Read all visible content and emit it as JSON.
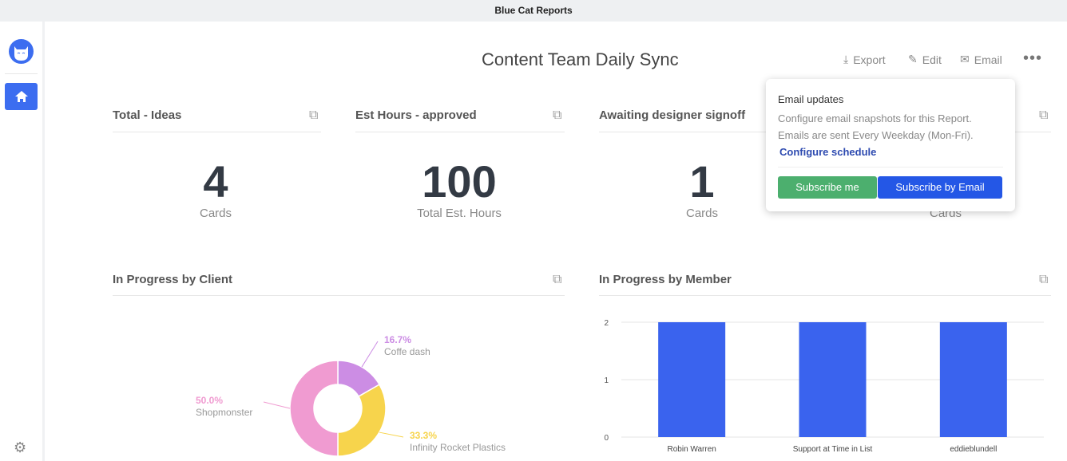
{
  "app": {
    "title": "Blue Cat Reports"
  },
  "sidebar": {
    "items": [
      {
        "icon": "home-icon",
        "active": true
      }
    ],
    "settings_icon": "gear-icon"
  },
  "header": {
    "title": "Content Team Daily Sync",
    "export": "Export",
    "edit": "Edit",
    "email": "Email"
  },
  "cards": [
    {
      "title": "Total - Ideas",
      "value": "4",
      "unit": "Cards"
    },
    {
      "title": "Est Hours - approved",
      "value": "100",
      "unit": "Total Est. Hours"
    },
    {
      "title": "Awaiting designer signoff",
      "value": "1",
      "unit": "Cards"
    },
    {
      "unit": "Cards"
    }
  ],
  "popup": {
    "title": "Email updates",
    "line1": "Configure email snapshots for this Report.",
    "line2": "Emails are sent Every Weekday (Mon-Fri).",
    "link": "Configure schedule",
    "subscribe_me": "Subscribe me",
    "subscribe_email": "Subscribe by Email"
  },
  "charts": {
    "client_title": "In Progress by Client",
    "member_title": "In Progress by Member"
  },
  "chart_data": [
    {
      "type": "pie",
      "donut": true,
      "slices": [
        {
          "label": "Coffe dash",
          "pct": "16.7%",
          "value": 16.7,
          "color": "#cc8de4"
        },
        {
          "label": "Infinity Rocket Plastics",
          "pct": "33.3%",
          "value": 33.3,
          "color": "#f7d44c"
        },
        {
          "label": "Shopmonster",
          "pct": "50.0%",
          "value": 50.0,
          "color": "#f09bd1"
        }
      ]
    },
    {
      "type": "bar",
      "categories": [
        "Robin Warren",
        "Support at Time in List",
        "eddieblundell"
      ],
      "values": [
        2,
        2,
        2
      ],
      "ylim": [
        0,
        2
      ],
      "yticks": [
        "0",
        "1",
        "2"
      ],
      "color": "#3a63ee",
      "grid": true
    }
  ]
}
